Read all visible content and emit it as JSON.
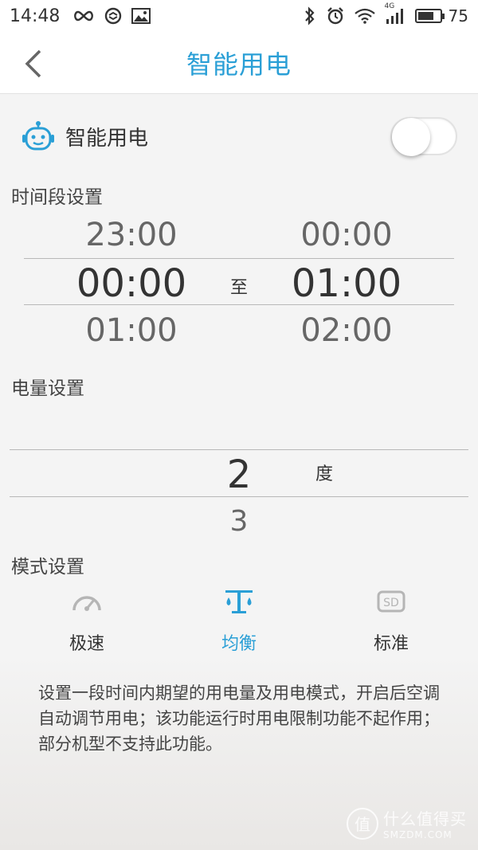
{
  "status_bar": {
    "time": "14:48",
    "network": "4G",
    "battery": "75",
    "battery_level": 0.75
  },
  "header": {
    "title": "智能用电"
  },
  "smart_power": {
    "label": "智能用电",
    "enabled": false
  },
  "time_section": {
    "label": "时间段设置",
    "start": {
      "prev": "23:00",
      "selected": "00:00",
      "next": "01:00"
    },
    "separator": "至",
    "end": {
      "prev": "00:00",
      "selected": "01:00",
      "next": "02:00"
    }
  },
  "power_section": {
    "label": "电量设置",
    "selected": "2",
    "next": "3",
    "unit": "度"
  },
  "mode_section": {
    "label": "模式设置",
    "items": [
      {
        "label": "极速",
        "icon": "speedometer-icon",
        "active": false
      },
      {
        "label": "均衡",
        "icon": "balance-scale-icon",
        "active": true
      },
      {
        "label": "标准",
        "icon": "sd-icon",
        "active": false
      }
    ]
  },
  "description": "设置一段时间内期望的用电量及用电模式，开启后空调自动调节用电；该功能运行时用电限制功能不起作用；部分机型不支持此功能。",
  "watermark": {
    "badge": "值",
    "cn": "什么值得买",
    "en": "SMZDM.COM"
  },
  "colors": {
    "accent": "#2a9fd6",
    "icon_gray": "#b5b5b5",
    "background": "#f4f4f4"
  }
}
